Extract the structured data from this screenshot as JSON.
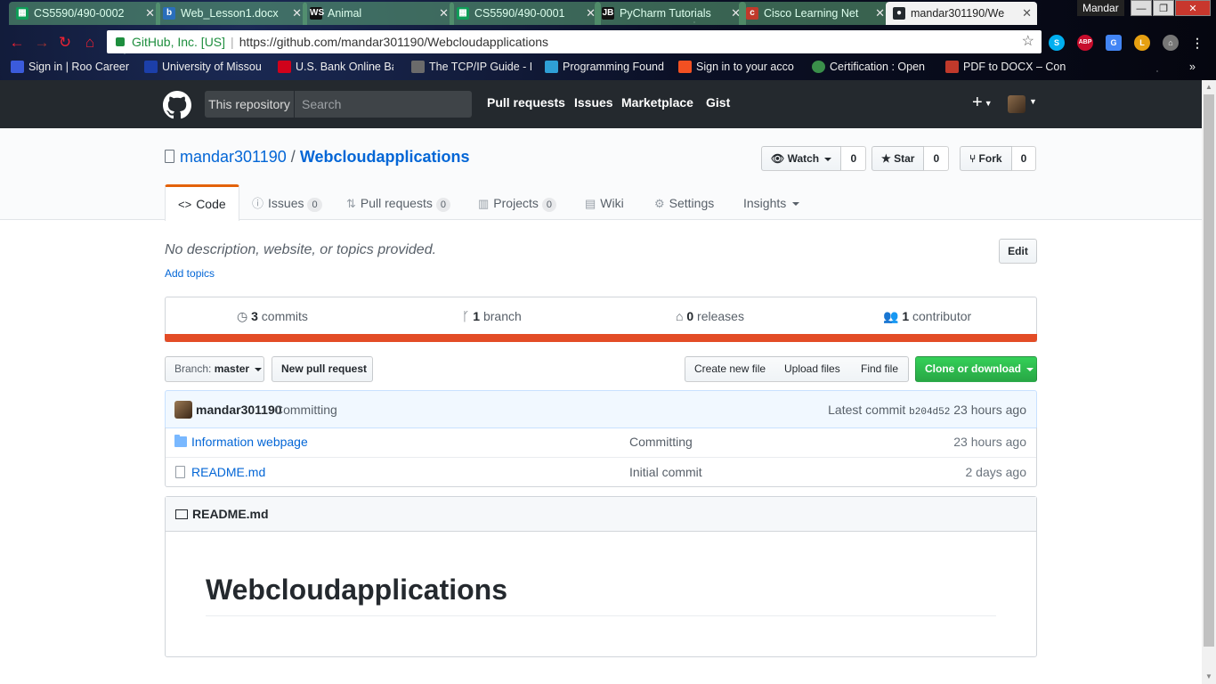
{
  "browser": {
    "tabs": [
      {
        "title": "CS5590/490-0002",
        "icon": "sheets-icon",
        "icon_color": "#0f9d58"
      },
      {
        "title": "Web_Lesson1.docx",
        "icon": "box-doc-icon",
        "icon_color": "#2a6ebb"
      },
      {
        "title": "Animal",
        "icon": "webstorm-icon",
        "icon_color": "#111111"
      },
      {
        "title": "CS5590/490-0001",
        "icon": "sheets-icon",
        "icon_color": "#0f9d58"
      },
      {
        "title": "PyCharm Tutorials",
        "icon": "jetbrains-icon",
        "icon_color": "#111111"
      },
      {
        "title": "Cisco Learning Net",
        "icon": "cisco-icon",
        "icon_color": "#c0392b"
      },
      {
        "title": "mandar301190/We",
        "icon": "github-icon",
        "icon_color": "#24292e"
      }
    ],
    "profile_name": "Mandar",
    "address": {
      "secure_label": "GitHub, Inc. [US]",
      "url": "https://github.com/mandar301190/Webcloudapplications"
    },
    "extensions": [
      {
        "name": "skype-icon",
        "label": "S",
        "color": "#00aff0"
      },
      {
        "name": "adblock-plus-icon",
        "label": "ABP",
        "color": "#c70d2c"
      },
      {
        "name": "google-translate-icon",
        "label": "G",
        "color": "#4285f4"
      },
      {
        "name": "lastpass-icon",
        "label": "L",
        "color": "#e6a011"
      },
      {
        "name": "home-extension-icon",
        "label": "⌂",
        "color": "#777777"
      }
    ],
    "bookmarks": [
      {
        "label": "Sign in | Roo Career",
        "color": "#3b5bdb"
      },
      {
        "label": "University of Missou",
        "color": "#1c3faa"
      },
      {
        "label": "U.S. Bank Online Ba",
        "color": "#d0021b"
      },
      {
        "label": "The TCP/IP Guide - In",
        "color": "#6b6b6b"
      },
      {
        "label": "Programming Found",
        "color": "#2f9fd6"
      },
      {
        "label": "Sign in to your acco",
        "color": "#f25022"
      },
      {
        "label": "Certification : Open",
        "color": "#3a8f4a"
      },
      {
        "label": "PDF to DOCX – Conv",
        "color": "#c0392b"
      }
    ]
  },
  "github": {
    "header": {
      "scope_label": "This repository",
      "search_placeholder": "Search",
      "nav": [
        "Pull requests",
        "Issues",
        "Marketplace",
        "Gist"
      ],
      "plus": "+"
    },
    "repo": {
      "owner": "mandar301190",
      "separator": "/",
      "name": "Webcloudapplications",
      "watch": {
        "label": "Watch",
        "count": "0"
      },
      "star": {
        "label": "Star",
        "count": "0"
      },
      "fork": {
        "label": "Fork",
        "count": "0"
      }
    },
    "tabs": {
      "code": "Code",
      "issues": {
        "label": "Issues",
        "count": "0"
      },
      "pulls": {
        "label": "Pull requests",
        "count": "0"
      },
      "projects": {
        "label": "Projects",
        "count": "0"
      },
      "wiki": "Wiki",
      "settings": "Settings",
      "insights": "Insights"
    },
    "description": "No description, website, or topics provided.",
    "add_topics": "Add topics",
    "edit_label": "Edit",
    "summary": {
      "commits": {
        "count": "3",
        "label": "commits"
      },
      "branch": {
        "count": "1",
        "label": "branch"
      },
      "releases": {
        "count": "0",
        "label": "releases"
      },
      "contributors": {
        "count": "1",
        "label": "contributor"
      }
    },
    "language_color": "#e34c26",
    "file_nav": {
      "branch_prefix": "Branch:",
      "branch_name": "master",
      "new_pr": "New pull request",
      "create_file": "Create new file",
      "upload_files": "Upload files",
      "find_file": "Find file",
      "clone": "Clone or download"
    },
    "latest_commit": {
      "author": "mandar301190",
      "message": "Committing",
      "prefix": "Latest commit",
      "sha": "b204d52",
      "age": "23 hours ago"
    },
    "files": [
      {
        "type": "dir",
        "name": "Information webpage",
        "message": "Committing",
        "age": "23 hours ago"
      },
      {
        "type": "file",
        "name": "README.md",
        "message": "Initial commit",
        "age": "2 days ago"
      }
    ],
    "readme": {
      "filename": "README.md",
      "heading": "Webcloudapplications"
    }
  }
}
